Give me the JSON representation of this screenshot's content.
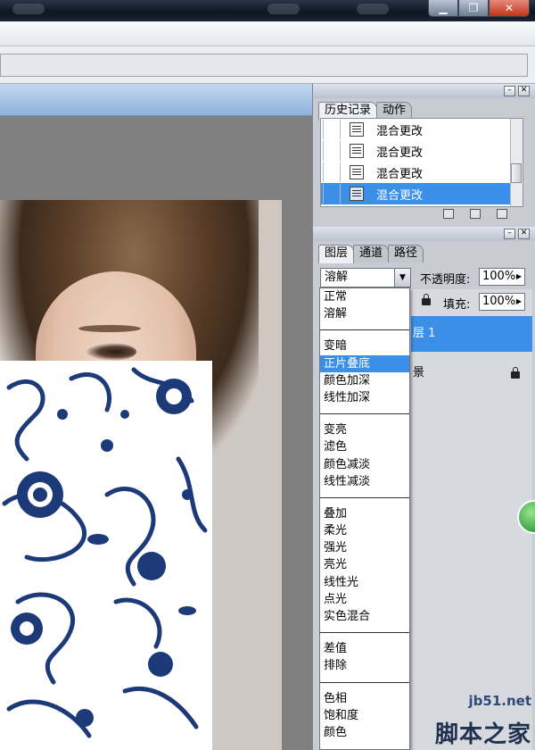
{
  "history_panel": {
    "tabs": [
      "历史记录",
      "动作"
    ],
    "rows": [
      "混合更改",
      "混合更改",
      "混合更改",
      "混合更改"
    ],
    "selected_index": 3
  },
  "layers_panel": {
    "tabs": [
      "图层",
      "通道",
      "路径"
    ],
    "blend_mode": "溶解",
    "opacity_label": "不透明度:",
    "opacity_value": "100%",
    "fill_label": "填充:",
    "fill_value": "100%",
    "layer_1_fragment": "层 1",
    "layer_2_fragment": "景"
  },
  "blend_menu": {
    "groups": [
      [
        "正常",
        "溶解"
      ],
      [
        "变暗",
        "正片叠底",
        "颜色加深",
        "线性加深"
      ],
      [
        "变亮",
        "滤色",
        "颜色减淡",
        "线性减淡"
      ],
      [
        "叠加",
        "柔光",
        "强光",
        "亮光",
        "线性光",
        "点光",
        "实色混合"
      ],
      [
        "差值",
        "排除"
      ],
      [
        "色相",
        "饱和度",
        "颜色"
      ]
    ],
    "highlighted": "正片叠底"
  },
  "watermark": {
    "site": "jb51.net",
    "name": "脚本之家"
  },
  "colors": {
    "selection": "#3b8fe8",
    "porcelain_blue": "#1d3a78"
  }
}
